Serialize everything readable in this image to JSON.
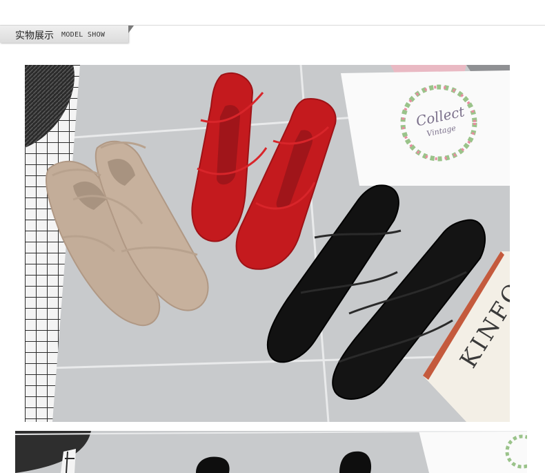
{
  "section": {
    "title_cn": "实物展示",
    "title_en": "MODEL SHOW"
  },
  "photo1": {
    "card_text": "Collect",
    "card_subtext": "Vintage",
    "book_text": "KINFO"
  },
  "colors": {
    "tab_bg": "#e4e4e4",
    "floor": "#c9cbcd",
    "beige_shoe": "#c3ad99",
    "red_shoe": "#c41a1e",
    "black_shoe": "#121212"
  }
}
